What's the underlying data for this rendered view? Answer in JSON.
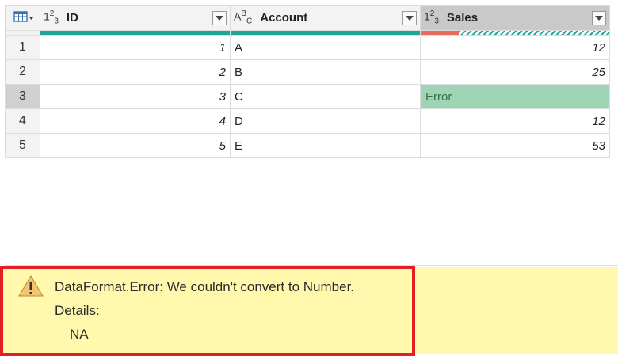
{
  "columns": [
    {
      "name": "ID",
      "type_icon": "123",
      "icon": "number-type-icon"
    },
    {
      "name": "Account",
      "type_icon": "ABC",
      "icon": "text-type-icon"
    },
    {
      "name": "Sales",
      "type_icon": "123",
      "icon": "number-type-icon"
    }
  ],
  "rows": [
    {
      "n": "1",
      "id": "1",
      "account": "A",
      "sales": "12"
    },
    {
      "n": "2",
      "id": "2",
      "account": "B",
      "sales": "25"
    },
    {
      "n": "3",
      "id": "3",
      "account": "C",
      "sales": "Error"
    },
    {
      "n": "4",
      "id": "4",
      "account": "D",
      "sales": "12"
    },
    {
      "n": "5",
      "id": "5",
      "account": "E",
      "sales": "53"
    }
  ],
  "selected_row": "3",
  "error_panel": {
    "message": "DataFormat.Error: We couldn't convert to Number.",
    "details_label": "Details:",
    "details_value": "NA"
  },
  "colors": {
    "valid_bar": "#1fa69a",
    "error_bar": "#e86c5c",
    "error_cell": "#9fd4b5",
    "panel_bg": "#fff8ad",
    "highlight_border": "#e41e25"
  },
  "icons": [
    "table-menu-icon",
    "number-type-icon",
    "text-type-icon",
    "dropdown-arrow-icon",
    "warning-icon"
  ]
}
